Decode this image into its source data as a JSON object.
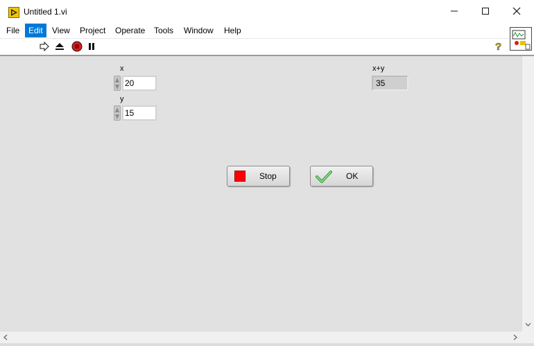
{
  "window": {
    "title": "Untitled 1.vi"
  },
  "icons": {
    "app": "labview-vi-icon",
    "minimize": "minimize-icon",
    "maximize": "maximize-icon",
    "close": "close-icon",
    "run": "run-arrow-icon",
    "run_continuously": "run-continuously-icon",
    "abort": "abort-execution-icon",
    "pause": "pause-icon",
    "help": "context-help-icon",
    "vi_connector": "vi-connector-icon"
  },
  "menu": {
    "items": [
      "File",
      "Edit",
      "View",
      "Project",
      "Operate",
      "Tools",
      "Window",
      "Help"
    ],
    "active": "Edit"
  },
  "controls": {
    "x": {
      "label": "x",
      "value": "20"
    },
    "y": {
      "label": "y",
      "value": "15"
    }
  },
  "indicator": {
    "label": "x+y",
    "value": "35"
  },
  "buttons": {
    "stop": "Stop",
    "ok": "OK"
  },
  "colors": {
    "panel_bg": "#e1e1e1",
    "menu_active": "#0078d7",
    "stop_red": "#ff0000",
    "ok_check_green": "#3aa33a",
    "abort_red": "#d42020"
  }
}
